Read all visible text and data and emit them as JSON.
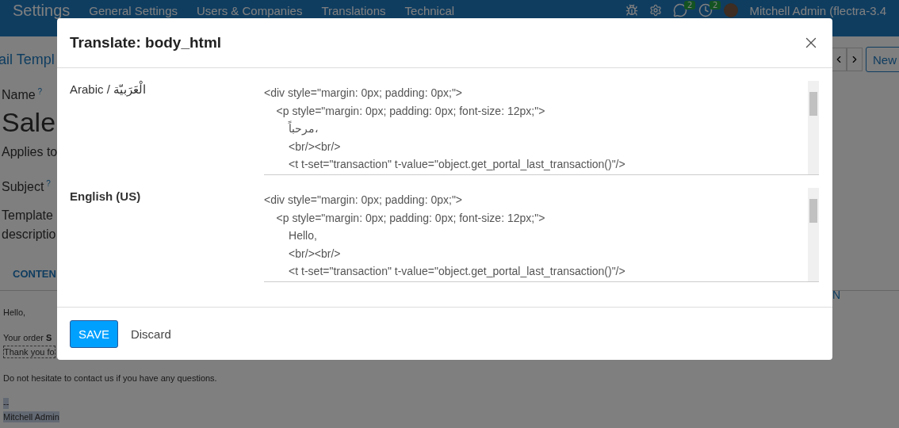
{
  "navbar": {
    "app": "Settings",
    "menu": [
      "General Settings",
      "Users & Companies",
      "Translations",
      "Technical"
    ],
    "badges": [
      "2",
      "2"
    ],
    "user": "Mitchell Admin (flectra-3.4"
  },
  "breadcrumb": "ail Templ",
  "pager": {
    "new_label": "New"
  },
  "form": {
    "labels": [
      {
        "text": "Name",
        "help": "?"
      },
      {
        "text": "Sale",
        "kind": "title"
      },
      {
        "text": "Applies to",
        "kind": "label"
      },
      {
        "text": "Subject",
        "help": "?"
      },
      {
        "text": "Template",
        "kind": "label"
      },
      {
        "text": "descriptio",
        "kind": "label"
      }
    ],
    "tab": "CONTEN",
    "side_link": "N"
  },
  "email_body": [
    {
      "text": "Hello,"
    },
    {
      "text": "Your order **S**",
      "blank_before": true
    },
    {
      "text": "Thank you fo",
      "kind": "dashed"
    },
    {
      "text": "Do not hesitate to contact us if you have any questions.",
      "blank_before": true
    },
    {
      "text": "--",
      "kind": "highlight",
      "blank_before": true
    },
    {
      "text": "Mitchell Admin",
      "kind": "highlight"
    }
  ],
  "dialog": {
    "title": "Translate: body_html",
    "translations": [
      {
        "language": "Arabic / الْعَرَبيّة",
        "bold": false,
        "lines": [
          "<div style=\"margin: 0px; padding: 0px;\">",
          "    <p style=\"margin: 0px; padding: 0px; font-size: 12px;\">",
          "        مرحباً،",
          "        <br/><br/>",
          "        <t t-set=\"transaction\" t-value=\"object.get_portal_last_transaction()\"/>"
        ]
      },
      {
        "language": "English (US)",
        "bold": true,
        "lines": [
          "<div style=\"margin: 0px; padding: 0px;\">",
          "    <p style=\"margin: 0px; padding: 0px; font-size: 12px;\">",
          "        Hello,",
          "        <br/><br/>",
          "        <t t-set=\"transaction\" t-value=\"object.get_portal_last_transaction()\"/>"
        ]
      }
    ],
    "buttons": [
      {
        "label": "SAVE",
        "kind": "primary"
      },
      {
        "label": "Discard",
        "kind": "link"
      }
    ]
  }
}
